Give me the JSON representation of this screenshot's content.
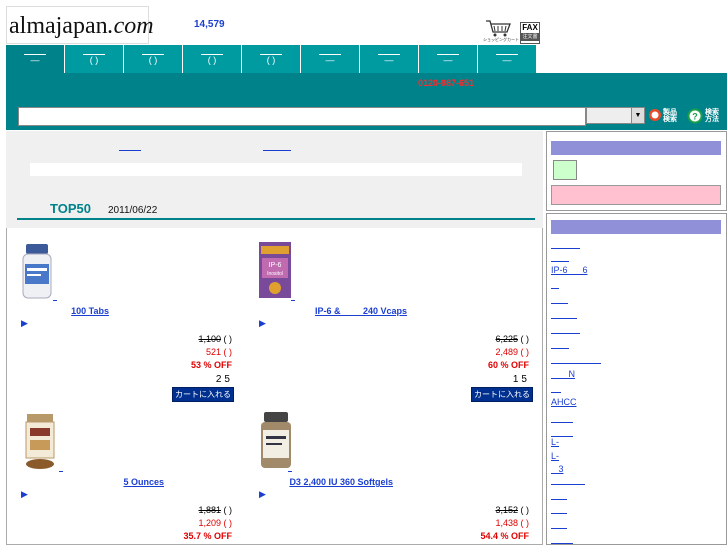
{
  "header": {
    "logo_text": "almajapan",
    "logo_suffix": ".com",
    "counter": "14,579",
    "cart_label": "ショッピングカート",
    "fax_label_top": "FAX",
    "fax_label_bottom": "注文書"
  },
  "nav": {
    "tabs": [
      {
        "label": "—"
      },
      {
        "label": "(  )"
      },
      {
        "label": "(  )"
      },
      {
        "label": "(  )"
      },
      {
        "label": "(  )"
      },
      {
        "label": "—"
      },
      {
        "label": "—"
      },
      {
        "label": "—"
      },
      {
        "label": "—"
      }
    ]
  },
  "band": {
    "phone": "0120-987-651",
    "search_placeholder": "",
    "search_button_label": "製品検索",
    "help_button_label": "検索方法"
  },
  "ranking": {
    "title": "TOP50",
    "date": "2011/06/22"
  },
  "products": [
    {
      "name": "100 Tabs",
      "old_price": "1,100",
      "new_price": "521",
      "off": "53 % OFF",
      "rank": "25",
      "cart": "カートに入れる"
    },
    {
      "name": "IP-6 &         240 Vcaps",
      "old_price": "6,225",
      "new_price": "2,489",
      "off": "60 % OFF",
      "rank": "15",
      "cart": "カートに入れる"
    },
    {
      "name": "5 Ounces",
      "old_price": "1,881",
      "new_price": "1,209",
      "off": "35.7 % OFF",
      "rank": "",
      "cart": ""
    },
    {
      "name": "D3 2,400 IU 360 Softgels",
      "old_price": "3,152",
      "new_price": "1,438",
      "off": "54.4 % OFF",
      "rank": "",
      "cart": ""
    }
  ],
  "sidebar": {
    "links": [
      "",
      "",
      "IP-6      6",
      "",
      "",
      "",
      "",
      "",
      "",
      "       N",
      "",
      "AHCC",
      "",
      "",
      "L-",
      "L-",
      "   3",
      "",
      "",
      "",
      ""
    ]
  },
  "colors": {
    "teal": "#00828a",
    "link": "#1a3ed0",
    "sale": "#e00000",
    "sidebar_header": "#9090d8"
  }
}
